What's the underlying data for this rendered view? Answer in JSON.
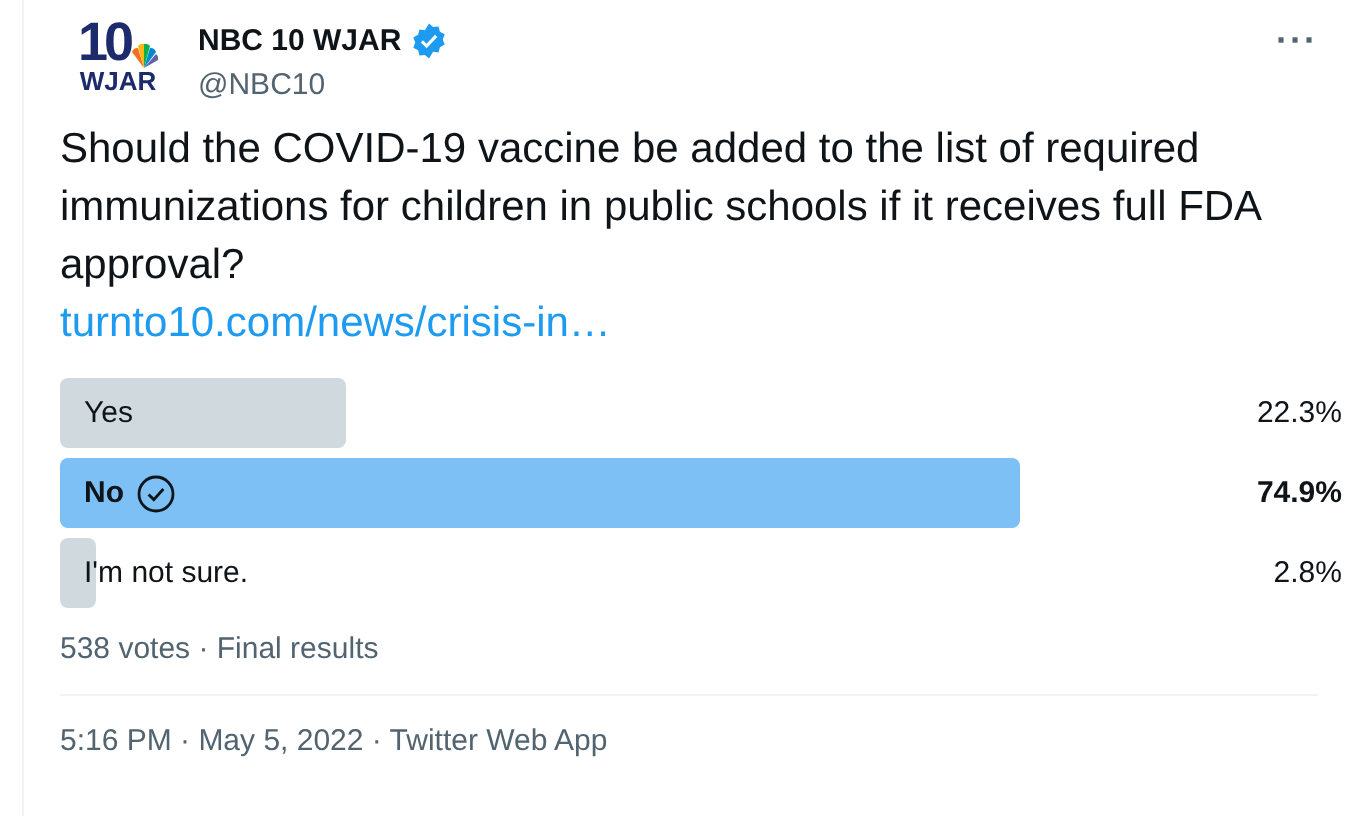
{
  "author": {
    "name": "NBC 10 WJAR",
    "handle": "@NBC10",
    "verified": true,
    "logo_number": "10",
    "logo_letters": "WJAR"
  },
  "more_button": "···",
  "text": "Should the COVID-19 vaccine be added to the list of required immunizations for children in public schools if it receives full FDA approval?",
  "link": "turnto10.com/news/crisis-in…",
  "poll": {
    "options": [
      {
        "label": "Yes",
        "percent": "22.3%",
        "selected": false
      },
      {
        "label": "No",
        "percent": "74.9%",
        "selected": true
      },
      {
        "label": "I'm not sure.",
        "percent": "2.8%",
        "selected": false
      }
    ],
    "summary": "538 votes · Final results"
  },
  "footer": "5:16 PM · May 5, 2022 · Twitter Web App"
}
